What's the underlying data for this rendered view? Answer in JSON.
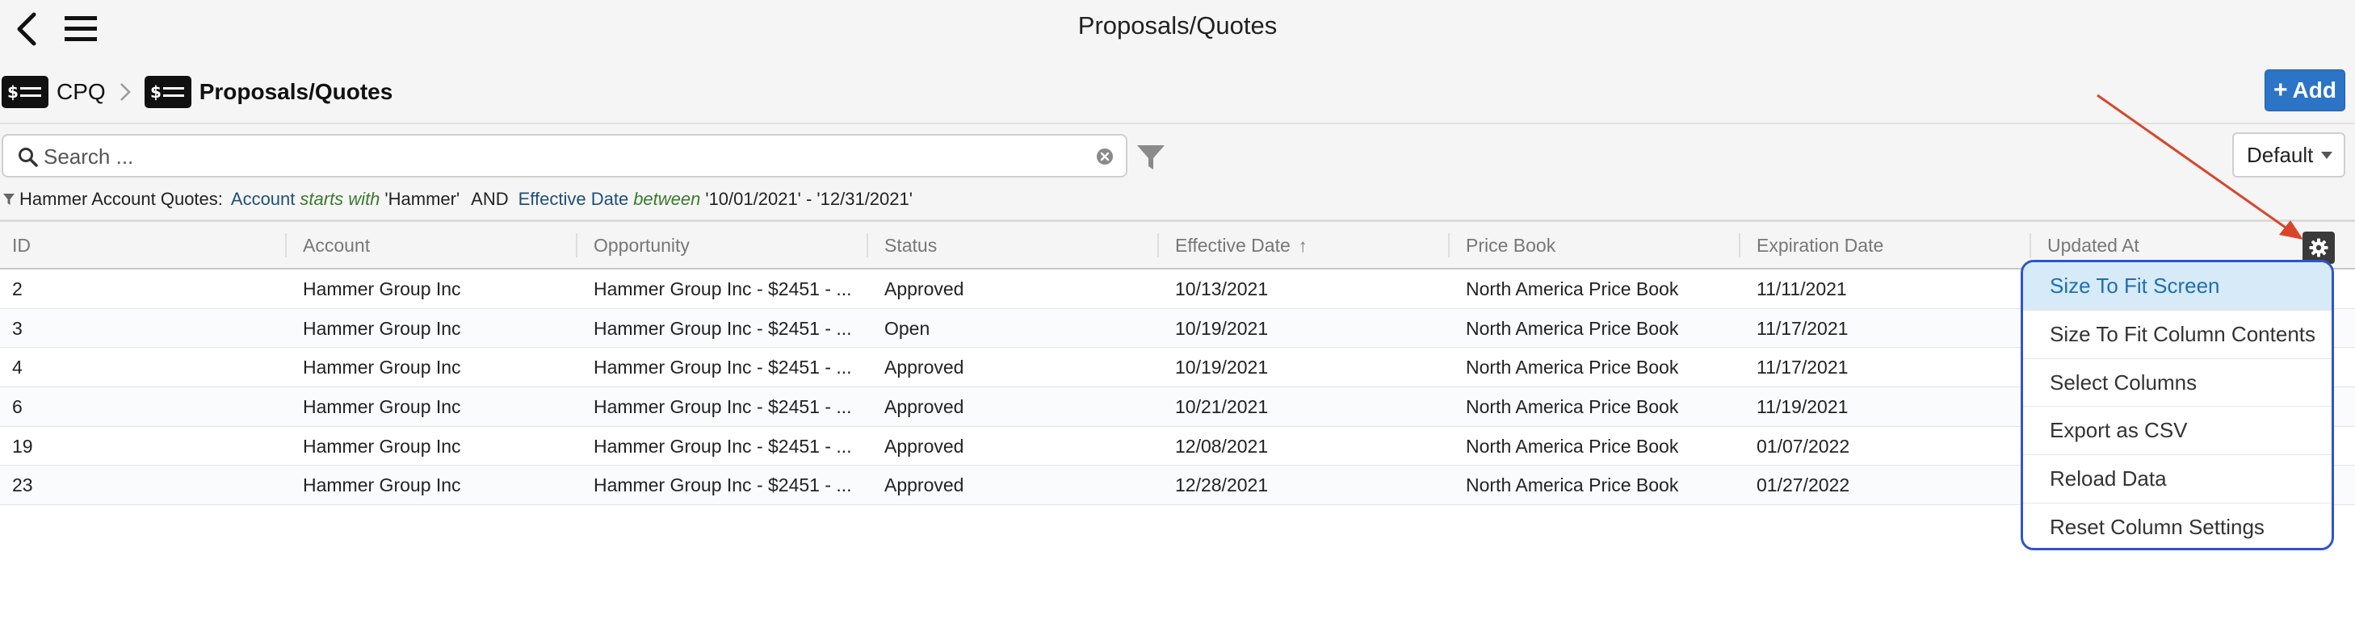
{
  "app": {
    "title": "Proposals/Quotes"
  },
  "breadcrumb": [
    {
      "label": "CPQ",
      "icon": "price-list-icon"
    },
    {
      "label": "Proposals/Quotes",
      "icon": "price-list-icon"
    }
  ],
  "toolbar": {
    "add_label": "Add"
  },
  "search": {
    "placeholder": "Search ...",
    "value": ""
  },
  "view": {
    "selected": "Default"
  },
  "filter_summary": {
    "name": "Hammer Account Quotes:",
    "conditions": [
      {
        "field": "Account",
        "op": "starts with",
        "value": "'Hammer'"
      },
      {
        "field": "Effective Date",
        "op": "between",
        "value": "'10/01/2021' - '12/31/2021'"
      }
    ],
    "joiner": "AND"
  },
  "grid": {
    "columns": [
      "ID",
      "Account",
      "Opportunity",
      "Status",
      "Effective Date",
      "Price Book",
      "Expiration Date",
      "Updated At"
    ],
    "sorted_column": "Effective Date",
    "sort_direction": "ascending",
    "rows": [
      [
        "2",
        "Hammer Group Inc",
        "Hammer Group Inc - $2451 - ...",
        "Approved",
        "10/13/2021",
        "North America Price Book",
        "11/11/2021"
      ],
      [
        "3",
        "Hammer Group Inc",
        "Hammer Group Inc - $2451 - ...",
        "Open",
        "10/19/2021",
        "North America Price Book",
        "11/17/2021"
      ],
      [
        "4",
        "Hammer Group Inc",
        "Hammer Group Inc - $2451 - ...",
        "Approved",
        "10/19/2021",
        "North America Price Book",
        "11/17/2021"
      ],
      [
        "6",
        "Hammer Group Inc",
        "Hammer Group Inc - $2451 - ...",
        "Approved",
        "10/21/2021",
        "North America Price Book",
        "11/19/2021"
      ],
      [
        "19",
        "Hammer Group Inc",
        "Hammer Group Inc - $2451 - ...",
        "Approved",
        "12/08/2021",
        "North America Price Book",
        "01/07/2022"
      ],
      [
        "23",
        "Hammer Group Inc",
        "Hammer Group Inc - $2451 - ...",
        "Approved",
        "12/28/2021",
        "North America Price Book",
        "01/27/2022"
      ]
    ]
  },
  "settings_menu": {
    "items": [
      "Size To Fit Screen",
      "Size To Fit Column Contents",
      "Select Columns",
      "Export as CSV",
      "Reload Data",
      "Reset Column Settings"
    ],
    "active_index": 0
  },
  "colors": {
    "accent": "#2b74c6",
    "menu_highlight_border": "#2e55c8",
    "annotation_arrow": "#d9452b"
  }
}
